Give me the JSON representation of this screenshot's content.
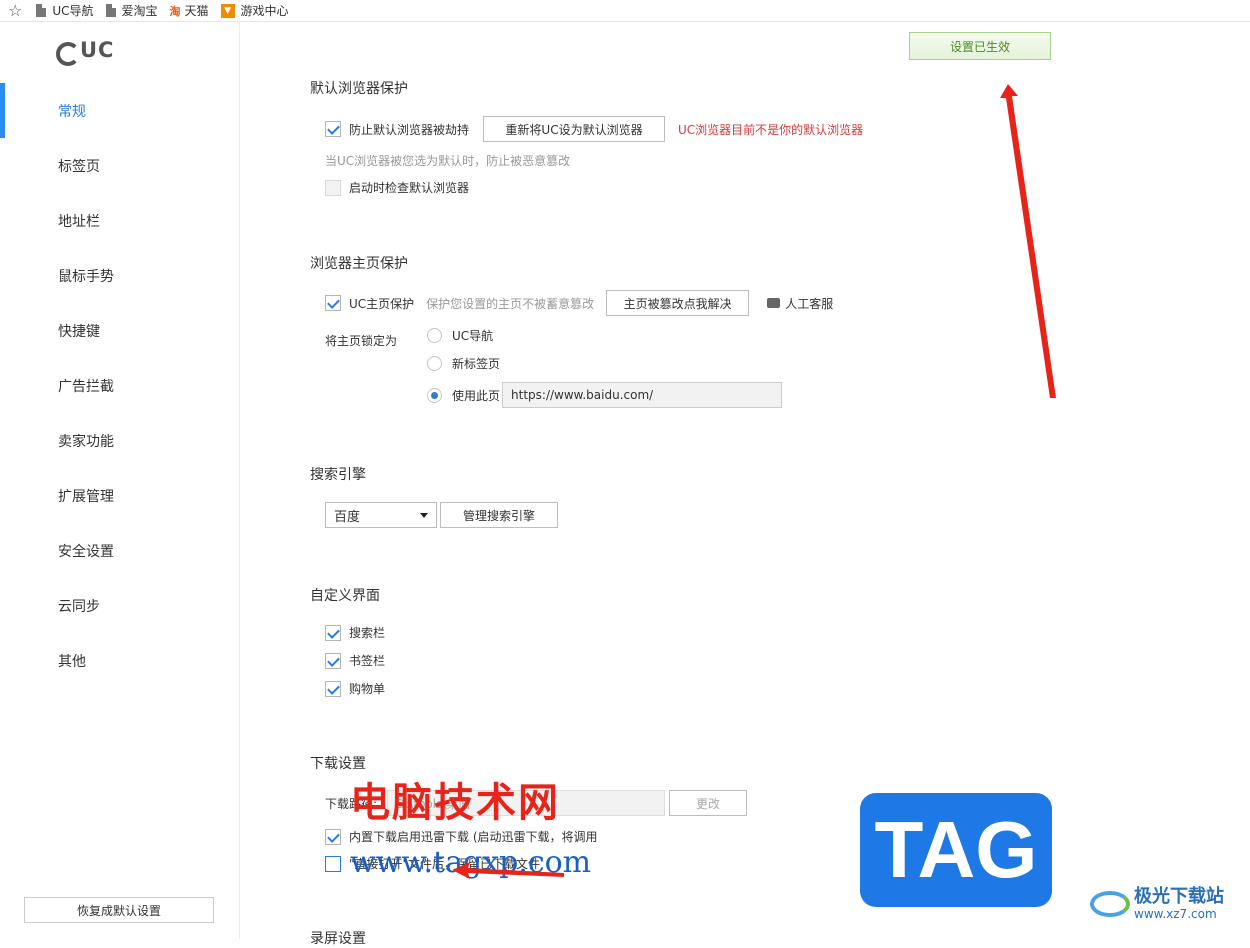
{
  "bookmarks": [
    "UC导航",
    "爱淘宝",
    "天猫",
    "游戏中心"
  ],
  "taobao_glyph": "淘",
  "logo": "UC",
  "nav": [
    "常规",
    "标签页",
    "地址栏",
    "鼠标手势",
    "快捷键",
    "广告拦截",
    "卖家功能",
    "扩展管理",
    "安全设置",
    "云同步",
    "其他"
  ],
  "restore_label": "恢复成默认设置",
  "applied_label": "设置已生效",
  "default_browser": {
    "title": "默认浏览器保护",
    "protect_label": "防止默认浏览器被劫持",
    "reset_button": "重新将UC设为默认浏览器",
    "warning": "UC浏览器目前不是你的默认浏览器",
    "hint": "当UC浏览器被您选为默认时，防止被恶意篡改",
    "check_on_start": "启动时检查默认浏览器"
  },
  "homepage": {
    "title": "浏览器主页保护",
    "protect_label": "UC主页保护",
    "protect_hint": "保护您设置的主页不被蓄意篡改",
    "fix_button": "主页被篡改点我解决",
    "service_label": "人工客服",
    "lock_label": "将主页锁定为",
    "options": [
      "UC导航",
      "新标签页",
      "使用此页"
    ],
    "selected_index": 2,
    "url": "https://www.baidu.com/"
  },
  "search": {
    "title": "搜索引擎",
    "selected": "百度",
    "manage_button": "管理搜索引擎"
  },
  "custom_ui": {
    "title": "自定义界面",
    "items": [
      "搜索栏",
      "书签栏",
      "购物单"
    ]
  },
  "download": {
    "title": "下载设置",
    "path_label": "下载路径:",
    "path_value": "D:\\tools\\桌面",
    "change_button": "更改",
    "xunlei_label": "内置下载启用迅雷下载 (启动迅雷下载，将调用",
    "keep_label": "\"直接打开\"文件后，保留已下载文件"
  },
  "next_section": "录屏设置",
  "watermark": {
    "cn": "电脑技术网",
    "url": "www.tagxp.com",
    "tag": "TAG",
    "site_name": "极光下载站",
    "site_url": "www.xz7.com"
  },
  "colors": {
    "accent": "#2a7ce0",
    "warning": "#d23c3c",
    "arrow": "#e8231a",
    "applied": "#4f8a2b"
  }
}
